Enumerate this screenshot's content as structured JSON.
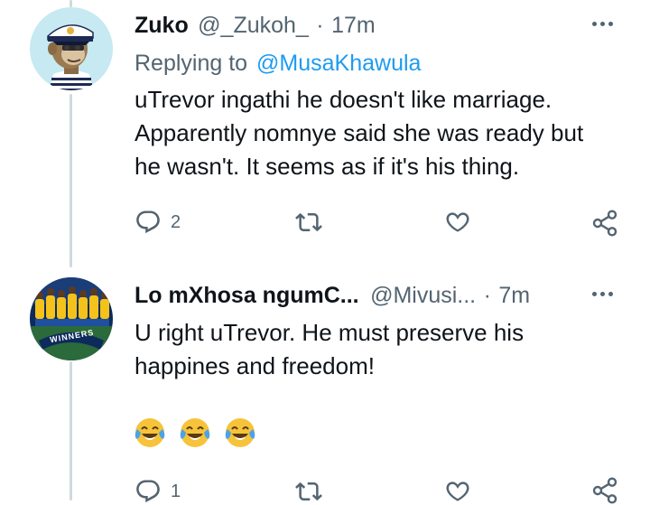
{
  "tweet1": {
    "display_name": "Zuko",
    "handle": "@_Zukoh_",
    "separator": "·",
    "time": "17m",
    "replying_label": "Replying to",
    "replying_handle": "@MusaKhawula",
    "text_lines": [
      "uTrevor ingathi he doesn't like marriage.",
      "Apparently nomnye said she was ready but",
      "he wasn't. It seems as if it's his thing."
    ],
    "reply_count": "2"
  },
  "tweet2": {
    "display_name": "Lo mXhosa ngumC...",
    "handle": "@Mivusi...",
    "separator": "·",
    "time": "7m",
    "avatar_banner_text": "WINNERS",
    "text_lines": [
      "U right uTrevor. He must preserve his",
      "happines and freedom!"
    ],
    "emojis": [
      "😂",
      "😂",
      "😂"
    ],
    "reply_count": "1"
  },
  "icons": {
    "reply": "reply-icon",
    "retweet": "retweet-icon",
    "like": "heart-icon",
    "share": "share-icon",
    "more": "more-options-icon"
  },
  "colors": {
    "text_primary": "#0f1419",
    "text_secondary": "#536471",
    "link": "#1d9bf0",
    "thread_line": "#cfd9de",
    "emoji_face": "#f6c33b",
    "emoji_tears": "#4aa3e8"
  }
}
